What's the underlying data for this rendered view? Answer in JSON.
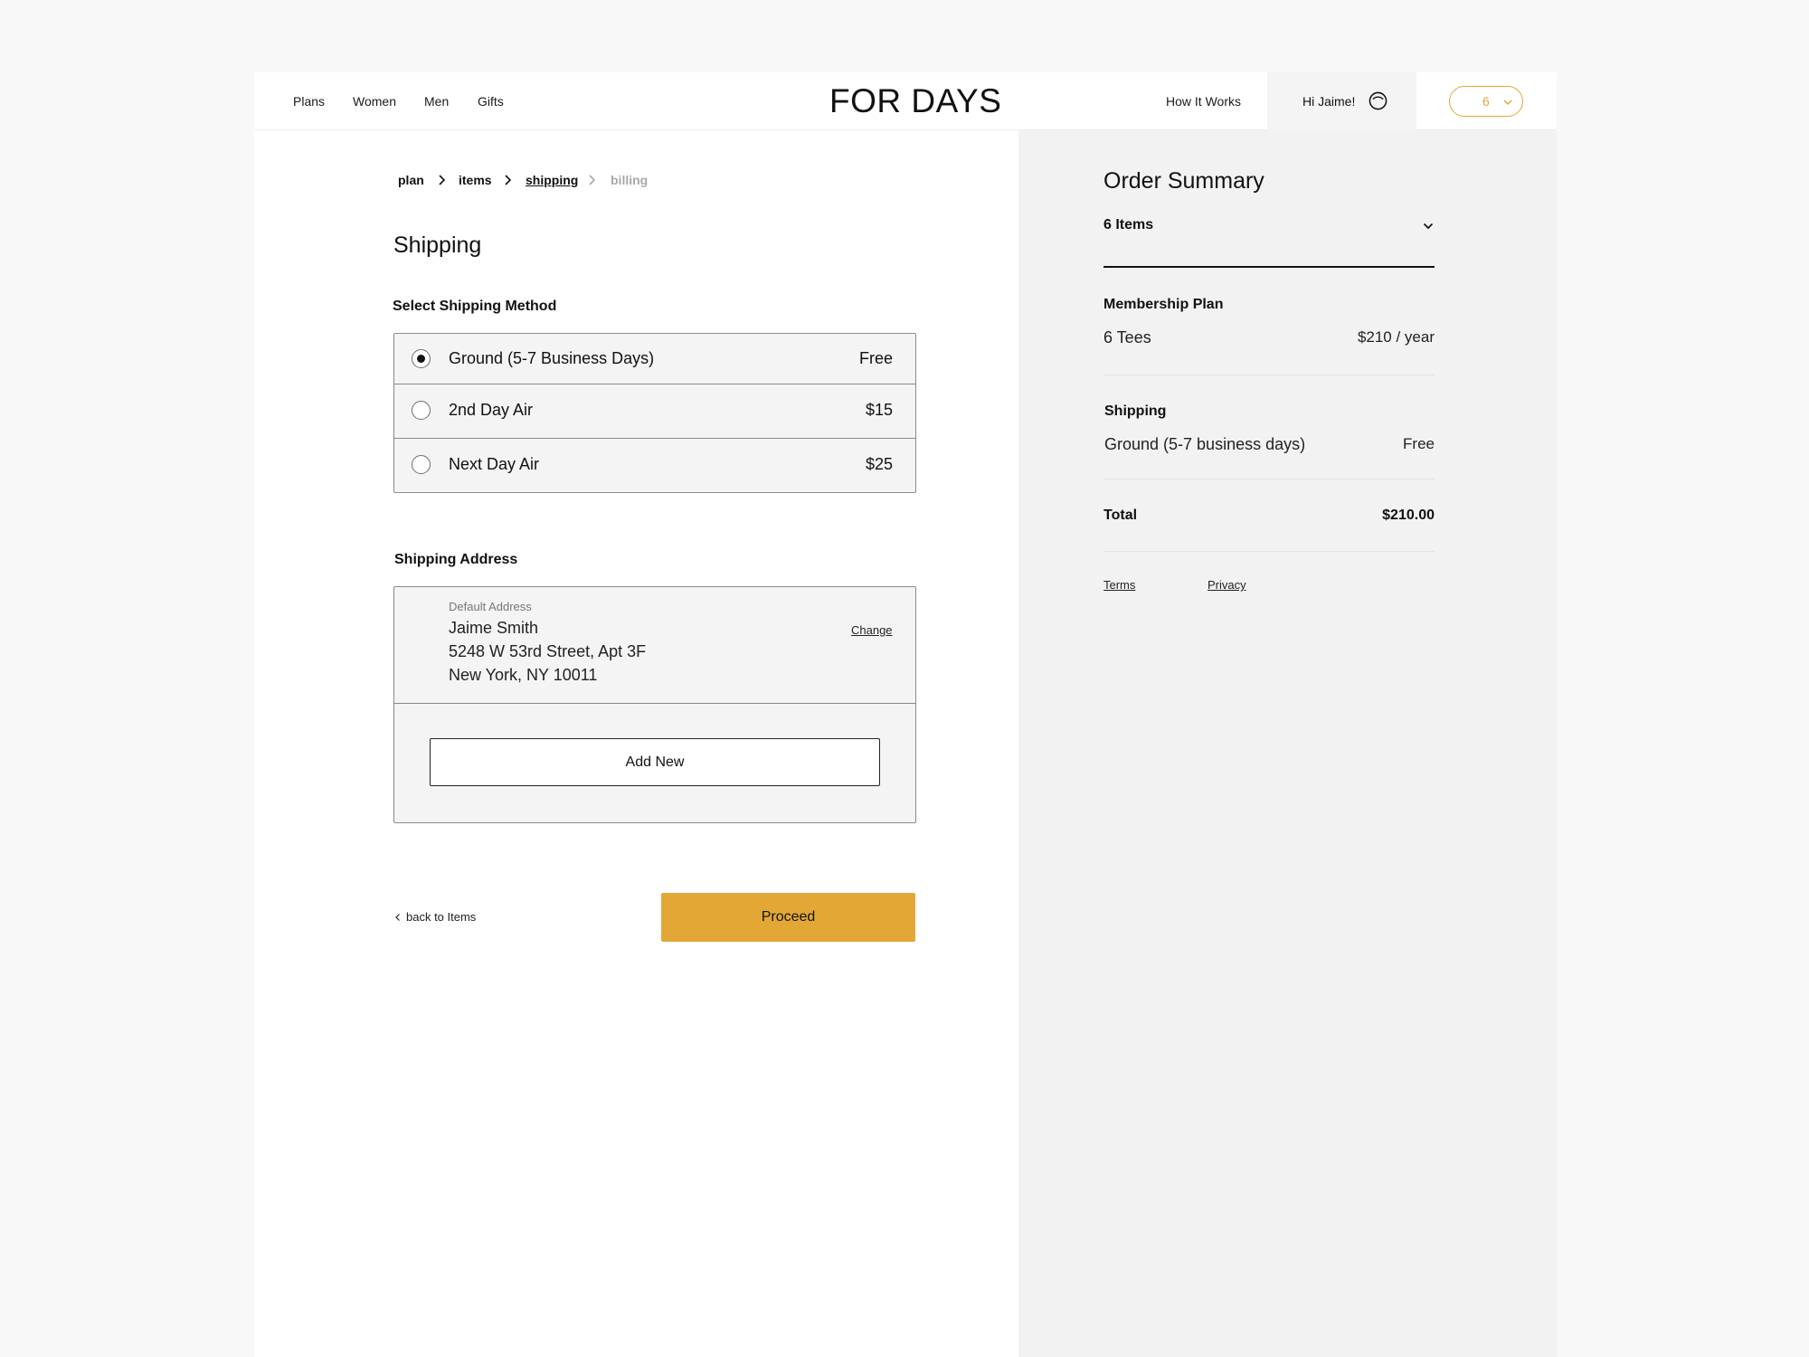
{
  "header": {
    "nav": [
      "Plans",
      "Women",
      "Men",
      "Gifts"
    ],
    "logo": "FOR DAYS",
    "how_it_works": "How It Works",
    "greeting": "Hi Jaime!",
    "cart_count": "6"
  },
  "breadcrumb": {
    "steps": [
      "plan",
      "items",
      "shipping",
      "billing"
    ],
    "active": "shipping"
  },
  "shipping": {
    "title": "Shipping",
    "method_label": "Select Shipping Method",
    "options": [
      {
        "label": "Ground (5-7 Business Days)",
        "price": "Free",
        "selected": true
      },
      {
        "label": "2nd Day Air",
        "price": "$15",
        "selected": false
      },
      {
        "label": "Next Day Air",
        "price": "$25",
        "selected": false
      }
    ],
    "address_label": "Shipping Address",
    "address": {
      "caption": "Default Address",
      "name": "Jaime Smith",
      "street": "5248 W 53rd Street, Apt 3F",
      "city": "New York, NY 10011",
      "change": "Change"
    },
    "add_new": "Add New",
    "back": "back to Items",
    "proceed": "Proceed"
  },
  "summary": {
    "title": "Order Summary",
    "items_toggle": "6 Items",
    "membership_heading": "Membership Plan",
    "membership_item": "6 Tees",
    "membership_price": "$210 / year",
    "shipping_heading": "Shipping",
    "shipping_item": "Ground (5-7 business days)",
    "shipping_price": "Free",
    "total_label": "Total",
    "total_value": "$210.00",
    "terms": "Terms",
    "privacy": "Privacy"
  },
  "colors": {
    "accent": "#e3a735",
    "summary_bg": "#f2f2f2",
    "option_bg": "#f4f4f4"
  }
}
